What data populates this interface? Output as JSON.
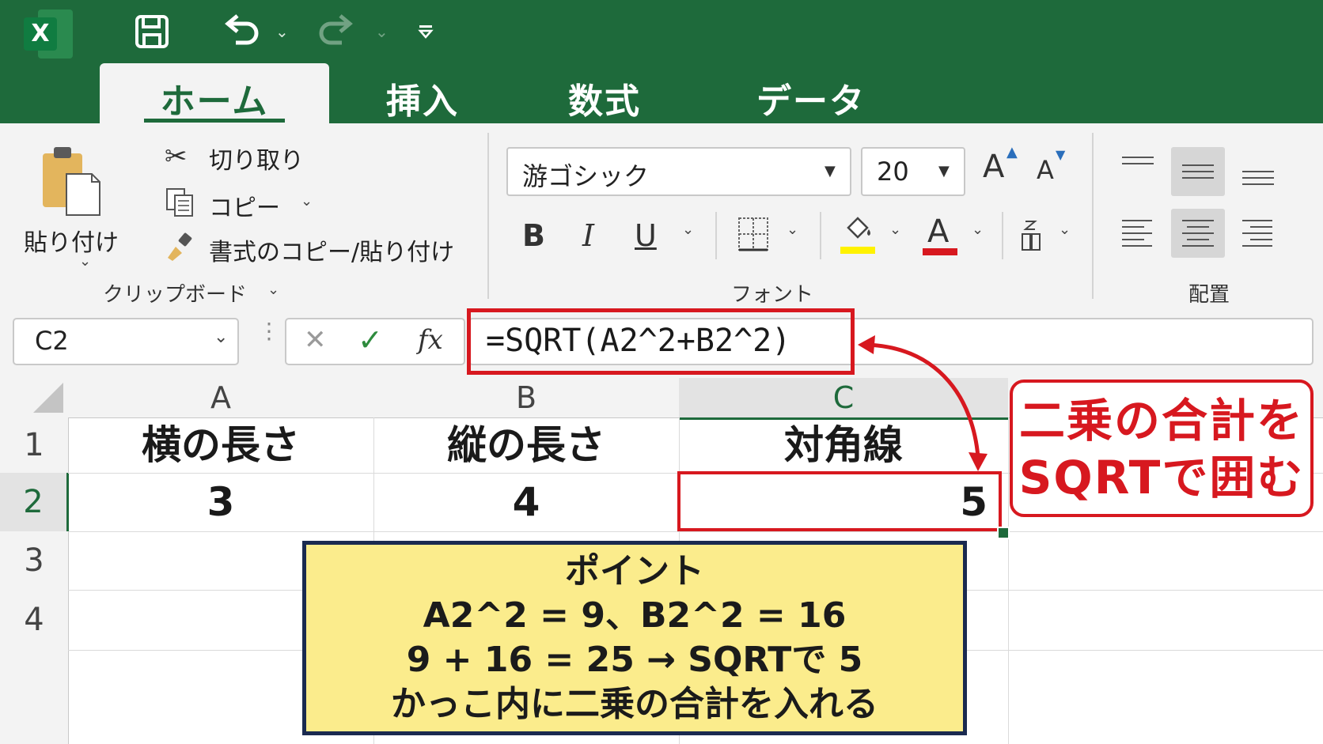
{
  "quick_access": {
    "excel_icon_letter": "X",
    "save_icon": "save-icon",
    "undo_icon": "undo-icon",
    "redo_icon": "redo-icon"
  },
  "tabs": [
    {
      "label": "ホーム"
    },
    {
      "label": "挿入"
    },
    {
      "label": "数式"
    },
    {
      "label": "データ"
    }
  ],
  "clipboard": {
    "paste_label": "貼り付け",
    "cut_label": "切り取り",
    "copy_label": "コピー",
    "format_painter_label": "書式のコピー/貼り付け",
    "group_label": "クリップボード"
  },
  "font": {
    "font_name": "游ゴシック",
    "font_size": "20",
    "grow_label": "A",
    "shrink_label": "A",
    "bold_label": "B",
    "italic_label": "I",
    "underline_label": "U",
    "font_color_label": "A",
    "phonetic_label": "ア亜",
    "group_label": "フォント",
    "fill_color": "#fff200",
    "font_color": "#d7181f"
  },
  "alignment": {
    "group_label": "配置"
  },
  "formula_bar": {
    "name_box": "C2",
    "cancel_symbol": "✕",
    "enter_symbol": "✓",
    "fx_label": "fx",
    "formula": "=SQRT(A2^2+B2^2)"
  },
  "sheet": {
    "columns": [
      "A",
      "B",
      "C"
    ],
    "rows": [
      "1",
      "2",
      "3",
      "4"
    ],
    "cells": {
      "A1": "横の長さ",
      "B1": "縦の長さ",
      "C1": "対角線",
      "A2": "3",
      "B2": "4",
      "C2": "5"
    }
  },
  "callout_note": {
    "line1": "二乗の合計を",
    "line2": "SQRTで囲む"
  },
  "tip_box": {
    "title": "ポイント",
    "line1": "A2^2 = 9、B2^2 = 16",
    "line2": "9 + 16 = 25 → SQRTで 5",
    "line3": "かっこ内に二乗の合計を入れる"
  },
  "colors": {
    "excel_green": "#1e6a3b",
    "highlight_red": "#d7181f",
    "tip_yellow": "#fbec8c",
    "tip_border": "#1a2a50"
  }
}
